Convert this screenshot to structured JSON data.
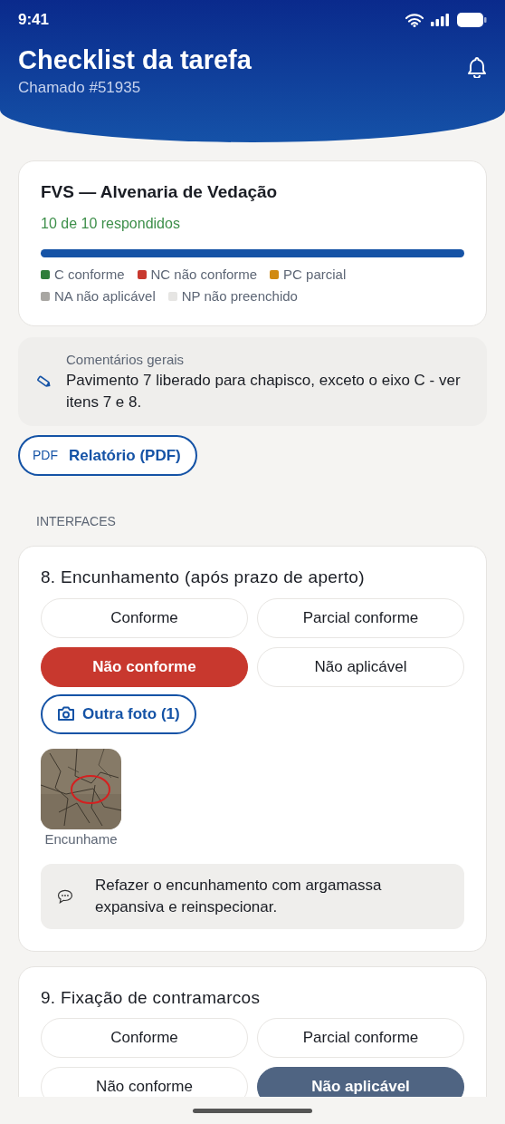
{
  "status_bar": {
    "time": "9:41"
  },
  "header": {
    "title": "Checklist da tarefa",
    "subtitle": "Chamado #51935"
  },
  "summary": {
    "title": "FVS — Alvenaria de Vedação",
    "answered": "10 de 10 respondidos",
    "level": 1.0,
    "legend": [
      {
        "label": "C conforme",
        "color": "#2e7d3a"
      },
      {
        "label": "NC não conforme",
        "color": "#c8382e"
      },
      {
        "label": "PC parcial",
        "color": "#d08a12"
      },
      {
        "label": "NA não aplicável",
        "color": "#a8a6a2"
      },
      {
        "label": "NP não preenchido",
        "color": "#e6e5e3"
      }
    ]
  },
  "comments": {
    "label": "Comentários gerais",
    "text": "Pavimento 7 liberado para chapisco, exceto o eixo C - ver itens 7 e 8."
  },
  "report_button": {
    "icon_text": "PDF",
    "label": "Relatório (PDF)"
  },
  "section": {
    "title": "INTERFACES"
  },
  "items": [
    {
      "title": "8. Encunhamento (após prazo de aperto)",
      "options": [
        {
          "label": "Conforme",
          "kind": "c",
          "selected": false
        },
        {
          "label": "Parcial conforme",
          "kind": "pc",
          "selected": false
        },
        {
          "label": "Não conforme",
          "kind": "nc",
          "selected": true
        },
        {
          "label": "Não aplicável",
          "kind": "na",
          "selected": false
        }
      ],
      "photo_button": "Outra foto (1)",
      "photos": [
        {
          "kind": "picture",
          "caption": "Encunhame"
        }
      ],
      "note": "Refazer o encunhamento com argamassa expansiva e reinspecionar."
    },
    {
      "title": "9. Fixação de contramarcos",
      "options": [
        {
          "label": "Conforme",
          "kind": "c",
          "selected": false
        },
        {
          "label": "Parcial conforme",
          "kind": "pc",
          "selected": false
        },
        {
          "label": "Não conforme",
          "kind": "nc",
          "selected": false
        },
        {
          "label": "Não aplicável",
          "kind": "na",
          "selected": true
        }
      ]
    }
  ]
}
